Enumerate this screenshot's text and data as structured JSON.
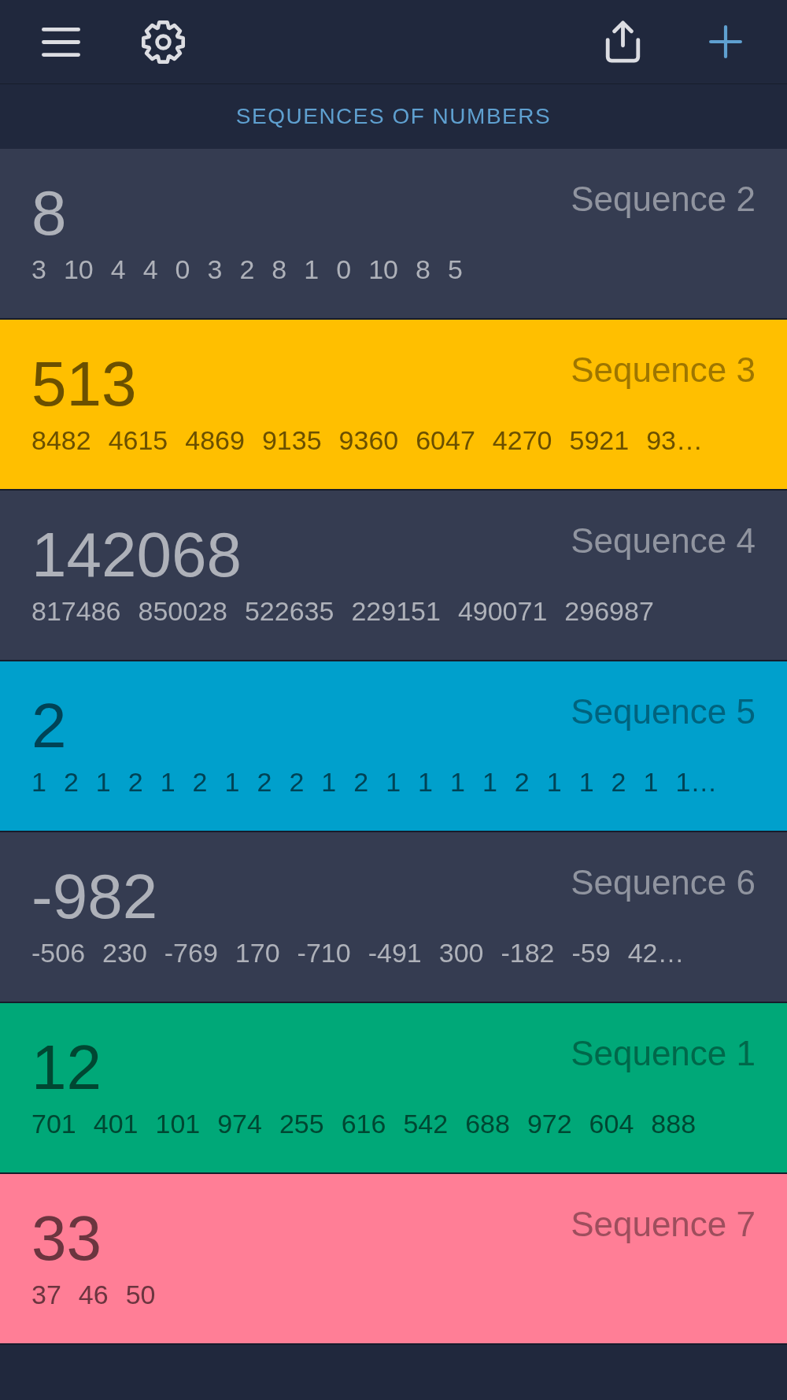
{
  "header": {
    "title": "SEQUENCES OF NUMBERS"
  },
  "sequences": [
    {
      "name": "Sequence 2",
      "value": "8",
      "color": "#353c51",
      "numbers": [
        "3",
        "10",
        "4",
        "4",
        "0",
        "3",
        "2",
        "8",
        "1",
        "0",
        "10",
        "8",
        "5"
      ]
    },
    {
      "name": "Sequence 3",
      "value": "513",
      "color": "#ffbf00",
      "numbers": [
        "8482",
        "4615",
        "4869",
        "9135",
        "9360",
        "6047",
        "4270",
        "5921",
        "93…"
      ]
    },
    {
      "name": "Sequence 4",
      "value": "142068",
      "color": "#353c51",
      "numbers": [
        "817486",
        "850028",
        "522635",
        "229151",
        "490071",
        "296987"
      ]
    },
    {
      "name": "Sequence 5",
      "value": "2",
      "color": "#00a0cc",
      "numbers": [
        "1",
        "2",
        "1",
        "2",
        "1",
        "2",
        "1",
        "2",
        "2",
        "1",
        "2",
        "1",
        "1",
        "1",
        "1",
        "2",
        "1",
        "1",
        "2",
        "1",
        "1…"
      ]
    },
    {
      "name": "Sequence 6",
      "value": "-982",
      "color": "#353c51",
      "numbers": [
        "-506",
        "230",
        "-769",
        "170",
        "-710",
        "-491",
        "300",
        "-182",
        "-59",
        "42…"
      ]
    },
    {
      "name": "Sequence 1",
      "value": "12",
      "color": "#00a878",
      "numbers": [
        "701",
        "401",
        "101",
        "974",
        "255",
        "616",
        "542",
        "688",
        "972",
        "604",
        "888"
      ]
    },
    {
      "name": "Sequence 7",
      "value": "33",
      "color": "#ff7e96",
      "numbers": [
        "37",
        "46",
        "50"
      ]
    }
  ]
}
